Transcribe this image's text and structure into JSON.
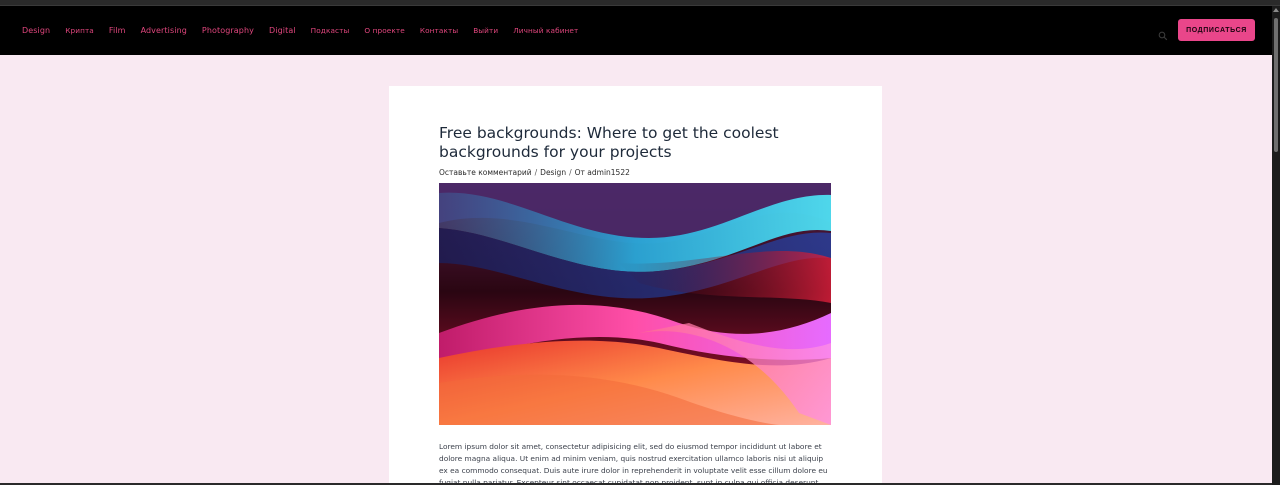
{
  "nav": {
    "items": [
      {
        "label": "Design"
      },
      {
        "label": "Крипта"
      },
      {
        "label": "Film"
      },
      {
        "label": "Advertising"
      },
      {
        "label": "Photography"
      },
      {
        "label": "Digital"
      },
      {
        "label": "Подкасты"
      },
      {
        "label": "О проекте"
      },
      {
        "label": "Контакты"
      },
      {
        "label": "Выйти"
      },
      {
        "label": "Личный кабинет"
      }
    ],
    "search_icon": "search-icon",
    "subscribe_label": "ПОДПИСАТЬСЯ"
  },
  "article": {
    "title": "Free backgrounds: Where to get the coolest backgrounds for your projects",
    "meta": {
      "comments": "Оставьте комментарий",
      "category": "Design",
      "author_prefix": "От",
      "author": "admin1522"
    },
    "body": "Lorem ipsum dolor sit amet, consectetur adipisicing elit, sed do eiusmod tempor incididunt ut labore et dolore magna aliqua. Ut enim ad minim veniam, quis nostrud exercitation ullamco laboris nisi ut aliquip ex ea commodo consequat. Duis aute irure dolor in reprehenderit in voluptate velit esse cillum dolore eu fugiat nulla pariatur. Excepteur sint occaecat cupidatat non proident, sunt in culpa qui officia deserunt"
  },
  "colors": {
    "accent": "#e9468a",
    "nav_link": "#e0467d",
    "page_bg": "#f9e9f2",
    "navbar_bg": "#000000"
  }
}
